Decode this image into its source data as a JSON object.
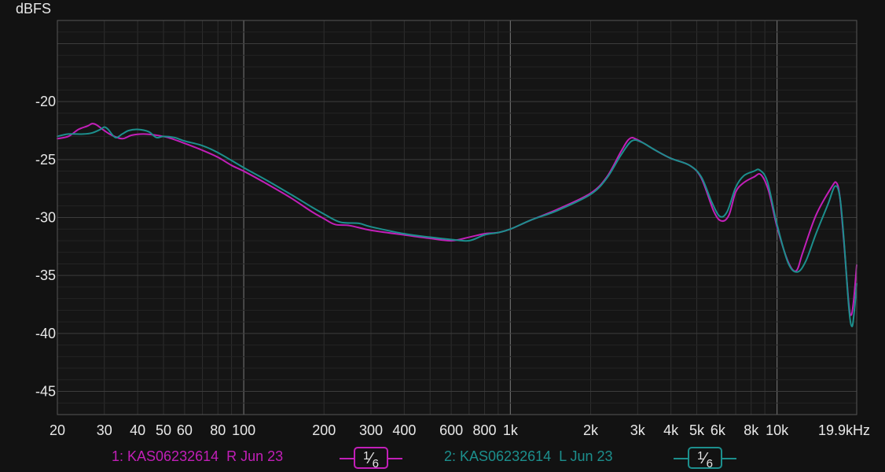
{
  "chart_data": {
    "type": "line",
    "ylabel": "dBFS",
    "xlabel": "",
    "x_scale": "log",
    "xlim": [
      20,
      19900
    ],
    "ylim": [
      -47,
      -13
    ],
    "grid": true,
    "x_ticks": [
      {
        "value": 20,
        "label": "20"
      },
      {
        "value": 30,
        "label": "30"
      },
      {
        "value": 40,
        "label": "40"
      },
      {
        "value": 50,
        "label": "50"
      },
      {
        "value": 60,
        "label": "60"
      },
      {
        "value": 80,
        "label": "80"
      },
      {
        "value": 100,
        "label": "100"
      },
      {
        "value": 200,
        "label": "200"
      },
      {
        "value": 300,
        "label": "300"
      },
      {
        "value": 400,
        "label": "400"
      },
      {
        "value": 600,
        "label": "600"
      },
      {
        "value": 800,
        "label": "800"
      },
      {
        "value": 1000,
        "label": "1k"
      },
      {
        "value": 2000,
        "label": "2k"
      },
      {
        "value": 3000,
        "label": "3k"
      },
      {
        "value": 4000,
        "label": "4k"
      },
      {
        "value": 5000,
        "label": "5k"
      },
      {
        "value": 6000,
        "label": "6k"
      },
      {
        "value": 8000,
        "label": "8k"
      },
      {
        "value": 10000,
        "label": "10k"
      },
      {
        "value": 19900,
        "label": "19.9kHz"
      }
    ],
    "y_ticks": [
      {
        "value": -20,
        "label": "-20"
      },
      {
        "value": -25,
        "label": "-25"
      },
      {
        "value": -30,
        "label": "-30"
      },
      {
        "value": -35,
        "label": "-35"
      },
      {
        "value": -40,
        "label": "-40"
      },
      {
        "value": -45,
        "label": "-45"
      }
    ],
    "series": [
      {
        "name": "1: KAS06232614  R Jun 23",
        "color": "#c21fb8",
        "smoothing": {
          "numerator": "1",
          "denominator": "6"
        },
        "points": [
          [
            20,
            -23.2
          ],
          [
            22,
            -23.0
          ],
          [
            24,
            -22.4
          ],
          [
            26,
            -22.1
          ],
          [
            27,
            -21.9
          ],
          [
            28,
            -22.0
          ],
          [
            30,
            -22.5
          ],
          [
            32,
            -22.9
          ],
          [
            35,
            -23.2
          ],
          [
            38,
            -22.9
          ],
          [
            42,
            -22.8
          ],
          [
            47,
            -22.9
          ],
          [
            52,
            -23.1
          ],
          [
            60,
            -23.6
          ],
          [
            70,
            -24.2
          ],
          [
            80,
            -24.8
          ],
          [
            90,
            -25.5
          ],
          [
            100,
            -26.0
          ],
          [
            120,
            -27.0
          ],
          [
            150,
            -28.3
          ],
          [
            180,
            -29.5
          ],
          [
            200,
            -30.1
          ],
          [
            220,
            -30.6
          ],
          [
            250,
            -30.7
          ],
          [
            300,
            -31.1
          ],
          [
            400,
            -31.5
          ],
          [
            500,
            -31.8
          ],
          [
            600,
            -32.0
          ],
          [
            700,
            -31.7
          ],
          [
            800,
            -31.4
          ],
          [
            900,
            -31.3
          ],
          [
            1000,
            -31.0
          ],
          [
            1200,
            -30.2
          ],
          [
            1500,
            -29.3
          ],
          [
            2000,
            -27.9
          ],
          [
            2300,
            -26.5
          ],
          [
            2600,
            -24.3
          ],
          [
            2800,
            -23.2
          ],
          [
            3000,
            -23.3
          ],
          [
            3500,
            -24.2
          ],
          [
            4000,
            -24.9
          ],
          [
            4700,
            -25.5
          ],
          [
            5200,
            -26.6
          ],
          [
            5800,
            -29.5
          ],
          [
            6200,
            -30.3
          ],
          [
            6600,
            -29.8
          ],
          [
            7000,
            -27.8
          ],
          [
            7500,
            -27.0
          ],
          [
            8200,
            -26.5
          ],
          [
            8700,
            -26.3
          ],
          [
            9300,
            -27.7
          ],
          [
            10000,
            -30.8
          ],
          [
            11000,
            -33.8
          ],
          [
            11800,
            -34.6
          ],
          [
            12500,
            -33.0
          ],
          [
            14000,
            -29.8
          ],
          [
            16000,
            -27.4
          ],
          [
            16700,
            -27.0
          ],
          [
            17200,
            -28.2
          ],
          [
            17800,
            -32.0
          ],
          [
            18600,
            -37.5
          ],
          [
            19000,
            -38.4
          ],
          [
            19400,
            -37.1
          ],
          [
            19900,
            -34.1
          ]
        ]
      },
      {
        "name": "2: KAS06232614  L Jun 23",
        "color": "#1c8f8d",
        "smoothing": {
          "numerator": "1",
          "denominator": "6"
        },
        "points": [
          [
            20,
            -23.0
          ],
          [
            22,
            -22.8
          ],
          [
            25,
            -22.8
          ],
          [
            27,
            -22.7
          ],
          [
            29,
            -22.4
          ],
          [
            30,
            -22.2
          ],
          [
            31,
            -22.4
          ],
          [
            33,
            -23.1
          ],
          [
            35,
            -22.8
          ],
          [
            37,
            -22.5
          ],
          [
            40,
            -22.4
          ],
          [
            44,
            -22.6
          ],
          [
            47,
            -23.1
          ],
          [
            50,
            -23.0
          ],
          [
            55,
            -23.1
          ],
          [
            60,
            -23.4
          ],
          [
            70,
            -23.8
          ],
          [
            80,
            -24.4
          ],
          [
            100,
            -25.7
          ],
          [
            120,
            -26.7
          ],
          [
            150,
            -28.0
          ],
          [
            180,
            -29.1
          ],
          [
            200,
            -29.7
          ],
          [
            230,
            -30.4
          ],
          [
            270,
            -30.5
          ],
          [
            300,
            -30.8
          ],
          [
            400,
            -31.4
          ],
          [
            500,
            -31.7
          ],
          [
            600,
            -31.9
          ],
          [
            700,
            -32.0
          ],
          [
            800,
            -31.5
          ],
          [
            900,
            -31.3
          ],
          [
            1000,
            -31.0
          ],
          [
            1200,
            -30.2
          ],
          [
            1500,
            -29.4
          ],
          [
            2000,
            -28.0
          ],
          [
            2300,
            -26.6
          ],
          [
            2600,
            -24.6
          ],
          [
            2850,
            -23.4
          ],
          [
            3100,
            -23.5
          ],
          [
            3500,
            -24.2
          ],
          [
            4000,
            -24.9
          ],
          [
            4700,
            -25.5
          ],
          [
            5200,
            -26.5
          ],
          [
            5700,
            -28.7
          ],
          [
            6100,
            -29.9
          ],
          [
            6500,
            -29.5
          ],
          [
            7000,
            -27.4
          ],
          [
            7500,
            -26.4
          ],
          [
            8200,
            -26.0
          ],
          [
            8600,
            -25.9
          ],
          [
            9200,
            -26.9
          ],
          [
            10000,
            -30.6
          ],
          [
            11000,
            -33.9
          ],
          [
            11900,
            -34.7
          ],
          [
            12800,
            -33.8
          ],
          [
            14000,
            -31.4
          ],
          [
            15500,
            -28.9
          ],
          [
            16500,
            -27.3
          ],
          [
            17200,
            -28.2
          ],
          [
            17800,
            -31.8
          ],
          [
            18600,
            -37.8
          ],
          [
            19100,
            -39.4
          ],
          [
            19500,
            -38.0
          ],
          [
            19900,
            -35.7
          ]
        ]
      }
    ]
  },
  "legend": [
    {
      "label": "1: KAS06232614  R Jun 23",
      "color": "#c21fb8",
      "smooth_num": "1",
      "smooth_den": "6"
    },
    {
      "label": "2: KAS06232614  L Jun 23",
      "color": "#1c8f8d",
      "smooth_num": "1",
      "smooth_den": "6"
    }
  ]
}
